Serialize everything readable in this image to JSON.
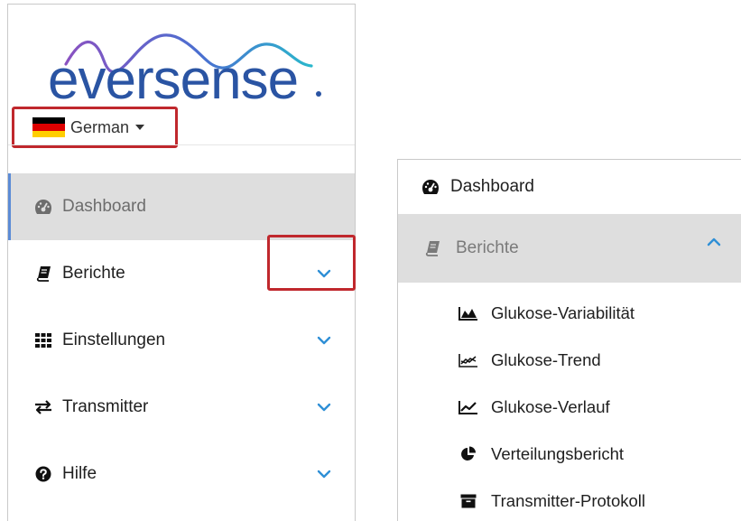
{
  "brand": {
    "logo_text": "eversense",
    "logo_color": "#2a54a3",
    "wave_colors": [
      "#7a4fb4",
      "#2aa9c9"
    ]
  },
  "language": {
    "label": "German",
    "flag_colors": [
      "#000000",
      "#dd0000",
      "#ffce00"
    ]
  },
  "nav": {
    "items": [
      {
        "label": "Dashboard",
        "icon": "dashboard-icon",
        "active": true
      },
      {
        "label": "Berichte",
        "icon": "book-icon",
        "expandable": true
      },
      {
        "label": "Einstellungen",
        "icon": "grid-icon",
        "expandable": true
      },
      {
        "label": "Transmitter",
        "icon": "exchange-icon",
        "expandable": true
      },
      {
        "label": "Hilfe",
        "icon": "question-circle-icon",
        "expandable": true
      }
    ]
  },
  "expanded": {
    "dashboard_label": "Dashboard",
    "section_label": "Berichte",
    "sub_items": [
      {
        "label": "Glukose-Variabilität",
        "icon": "area-chart-icon"
      },
      {
        "label": "Glukose-Trend",
        "icon": "trend-chart-icon"
      },
      {
        "label": "Glukose-Verlauf",
        "icon": "line-chart-icon"
      },
      {
        "label": "Verteilungsbericht",
        "icon": "pie-chart-icon"
      },
      {
        "label": "Transmitter-Protokoll",
        "icon": "archive-icon"
      }
    ]
  },
  "colors": {
    "highlight": "#c0282d",
    "active_bg": "#dedede",
    "active_bar": "#5b8bd6",
    "chevron": "#2f8fd6"
  }
}
